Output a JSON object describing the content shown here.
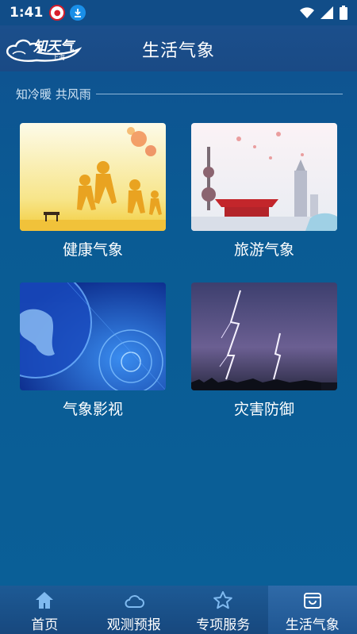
{
  "status_bar": {
    "time": "1:41",
    "notification_icons": [
      "calendar-badge-icon",
      "download-icon"
    ],
    "system_icons": [
      "wifi-icon",
      "signal-icon",
      "battery-icon"
    ]
  },
  "app_bar": {
    "logo_text": "知天气",
    "logo_sub": "上海",
    "title": "生活气象"
  },
  "section": {
    "title": "知冷暖 共风雨"
  },
  "cards": [
    {
      "label": "健康气象",
      "icon": "health-weather-image"
    },
    {
      "label": "旅游气象",
      "icon": "travel-weather-image"
    },
    {
      "label": "气象影视",
      "icon": "weather-video-image"
    },
    {
      "label": "灾害防御",
      "icon": "disaster-defense-image"
    }
  ],
  "tabs": [
    {
      "label": "首页",
      "icon": "home-icon",
      "active": false
    },
    {
      "label": "观测预报",
      "icon": "cloud-icon",
      "active": false
    },
    {
      "label": "专项服务",
      "icon": "star-icon",
      "active": false
    },
    {
      "label": "生活气象",
      "icon": "bag-icon",
      "active": true
    }
  ],
  "colors": {
    "background": "#0b5a93",
    "app_bar": "#1b4f8c",
    "tab_icon": "#7fbaf0"
  }
}
